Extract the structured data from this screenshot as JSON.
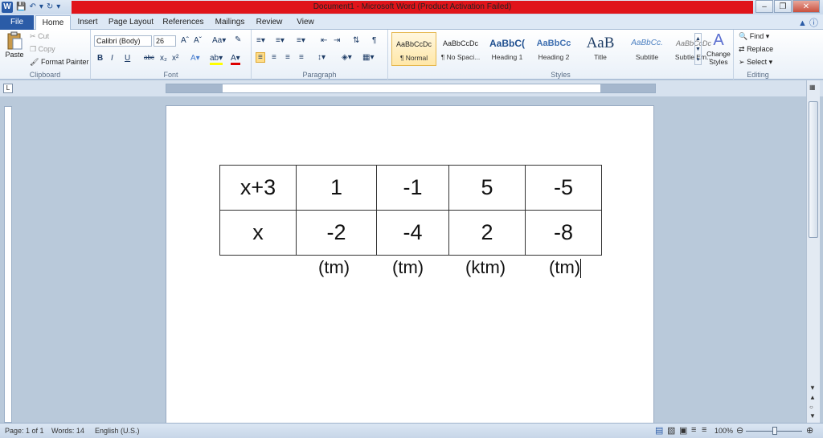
{
  "window": {
    "title": "Document1 - Microsoft Word (Product Activation Failed)",
    "app_icon": "word-icon"
  },
  "tabs": [
    "File",
    "Home",
    "Insert",
    "Page Layout",
    "References",
    "Mailings",
    "Review",
    "View"
  ],
  "ribbon": {
    "clipboard": {
      "paste": "Paste",
      "cut": "Cut",
      "copy": "Copy",
      "format_painter": "Format Painter",
      "label": "Clipboard"
    },
    "font": {
      "name": "Calibri (Body)",
      "size": "26",
      "label": "Font"
    },
    "paragraph": {
      "label": "Paragraph"
    },
    "styles": {
      "label": "Styles",
      "items": [
        {
          "sample": "AaBbCcDc",
          "name": "¶ Normal"
        },
        {
          "sample": "AaBbCcDc",
          "name": "¶ No Spaci..."
        },
        {
          "sample": "AaBbC(",
          "name": "Heading 1"
        },
        {
          "sample": "AaBbCc",
          "name": "Heading 2"
        },
        {
          "sample": "AaB",
          "name": "Title"
        },
        {
          "sample": "AaBbCc.",
          "name": "Subtitle"
        },
        {
          "sample": "AaBbCcDc",
          "name": "Subtle Em..."
        }
      ],
      "change_styles": "Change Styles"
    },
    "editing": {
      "find": "Find",
      "replace": "Replace",
      "select": "Select",
      "label": "Editing"
    }
  },
  "document": {
    "table": [
      [
        "x+3",
        "1",
        "-1",
        "5",
        "-5"
      ],
      [
        "x",
        "-2",
        "-4",
        "2",
        "-8"
      ]
    ],
    "notes": [
      "(tm)",
      "(tm)",
      "(ktm)",
      "(tm)"
    ]
  },
  "status": {
    "page": "Page: 1 of 1",
    "words": "Words: 14",
    "language": "English (U.S.)",
    "zoom": "100%"
  },
  "colors": {
    "title_bar": "#e0141a",
    "file_tab": "#2b5ca7",
    "background": "#b9c9da"
  }
}
